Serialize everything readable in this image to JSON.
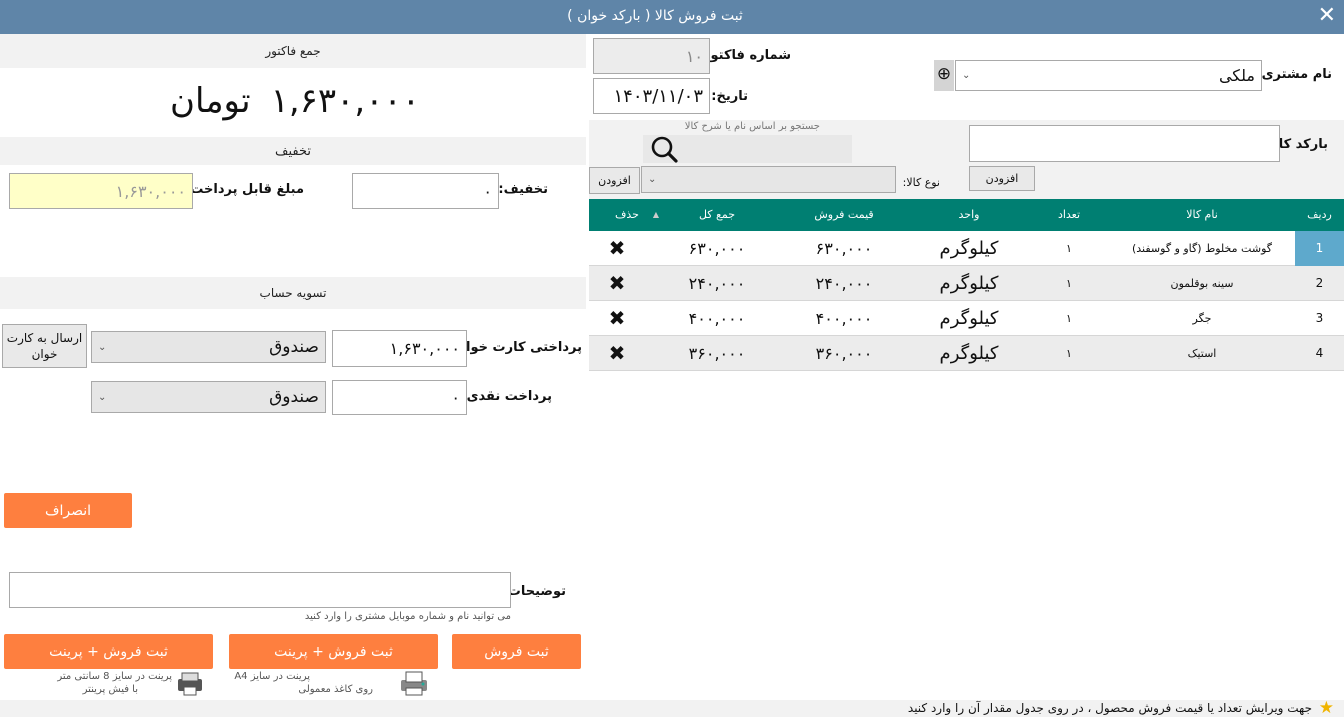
{
  "window": {
    "title": "ثبت فروش کالا ( بارکد خوان )",
    "close_glyph": "✕"
  },
  "invoice_total": {
    "header": "جمع فاکتور",
    "amount": "۱,۶۳۰,۰۰۰",
    "currency": "تومان"
  },
  "discount": {
    "header": "تخفیف",
    "discount_label": "تخفیف:",
    "discount_value": "۰",
    "payable_label": "مبلغ قابل پرداخت:",
    "payable_value": "۱,۶۳۰,۰۰۰"
  },
  "settlement": {
    "header": "تسویه حساب",
    "card_label": "پرداختی کارت خوان:",
    "card_value": "۱,۶۳۰,۰۰۰",
    "card_account": "صندوق",
    "send_card_button": "ارسال به کارت خوان",
    "cash_label": "پرداخت نقدی:",
    "cash_value": "۰",
    "cash_account": "صندوق",
    "cancel_button": "انصراف"
  },
  "notes": {
    "label": "توضیحات:",
    "value": "",
    "hint": "می توانید نام و شماره موبایل مشتری را وارد کنید"
  },
  "actions": {
    "save_print_8cm": "ثبت فروش + پرینت",
    "save_print_8cm_hint1": "پرینت در سایز 8 سانتی متر",
    "save_print_8cm_hint2": "با فیش پرینتر",
    "save_print_a4": "ثبت فروش + پرینت",
    "save_print_a4_hint1": "پرینت در سایز A4",
    "save_print_a4_hint2": "روی کاغذ معمولی",
    "save": "ثبت فروش"
  },
  "header_form": {
    "invoice_no_label": "شماره فاکتور:",
    "invoice_no_value": "۱۰",
    "date_label": "تاریخ:",
    "date_value": "۱۴۰۳/۱۱/۰۳",
    "customer_label": "نام مشتری:",
    "customer_value": "ملکی",
    "add_customer_glyph": "⊕"
  },
  "product_search": {
    "barcode_label": "بارکد کالا:",
    "barcode_value": "",
    "search_hint": "جستجو بر اساس نام یا شرح کالا",
    "search_value": "",
    "add_button_barcode": "افزودن",
    "type_label": "نوع کالا:",
    "type_value": "",
    "add_button_type": "افزودن"
  },
  "table": {
    "columns": [
      "ردیف",
      "نام کالا",
      "تعداد",
      "واحد",
      "قیمت فروش",
      "جمع کل",
      "حذف"
    ],
    "sort_glyph": "▲",
    "delete_glyph": "✖",
    "rows": [
      {
        "idx": "1",
        "name": "گوشت مخلوط (گاو و گوسفند)",
        "qty": "۱",
        "unit": "کیلوگرم",
        "price": "۶۳۰,۰۰۰",
        "total": "۶۳۰,۰۰۰"
      },
      {
        "idx": "2",
        "name": "سینه بوقلمون",
        "qty": "۱",
        "unit": "کیلوگرم",
        "price": "۲۴۰,۰۰۰",
        "total": "۲۴۰,۰۰۰"
      },
      {
        "idx": "3",
        "name": "جگر",
        "qty": "۱",
        "unit": "کیلوگرم",
        "price": "۴۰۰,۰۰۰",
        "total": "۴۰۰,۰۰۰"
      },
      {
        "idx": "4",
        "name": "استیک",
        "qty": "۱",
        "unit": "کیلوگرم",
        "price": "۳۶۰,۰۰۰",
        "total": "۳۶۰,۰۰۰"
      }
    ]
  },
  "status": {
    "text": "جهت ویرایش تعداد یا قیمت فروش محصول ، در روی جدول مقدار آن را وارد کنید"
  },
  "colors": {
    "titlebar": "#5f85a8",
    "table_header": "#007f72",
    "orange_button": "#fe7f3f",
    "selected_cell": "#5ea9cc",
    "payable_bg": "#ffffc8"
  }
}
